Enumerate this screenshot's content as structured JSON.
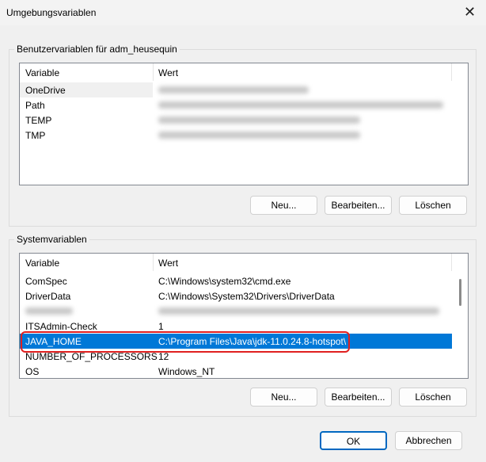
{
  "window": {
    "title": "Umgebungsvariablen",
    "close_icon": "close-icon"
  },
  "user_group": {
    "label": "Benutzervariablen für adm_heusequin",
    "columns": [
      "Variable",
      "Wert"
    ],
    "rows": [
      {
        "name": "OneDrive"
      },
      {
        "name": "Path"
      },
      {
        "name": "TEMP"
      },
      {
        "name": "TMP"
      }
    ],
    "buttons": {
      "new": "Neu...",
      "edit": "Bearbeiten...",
      "delete": "Löschen"
    }
  },
  "system_group": {
    "label": "Systemvariablen",
    "columns": [
      "Variable",
      "Wert"
    ],
    "rows": [
      {
        "name": "ComSpec",
        "value": "C:\\Windows\\system32\\cmd.exe"
      },
      {
        "name": "DriverData",
        "value": "C:\\Windows\\System32\\Drivers\\DriverData"
      },
      {
        "name": "",
        "value": ""
      },
      {
        "name": "ITSAdmin-Check",
        "value": "1"
      },
      {
        "name": "JAVA_HOME",
        "value": "C:\\Program Files\\Java\\jdk-11.0.24.8-hotspot\\"
      },
      {
        "name": "NUMBER_OF_PROCESSORS",
        "value": "12"
      },
      {
        "name": "OS",
        "value": "Windows_NT"
      }
    ],
    "selected": "JAVA_HOME",
    "buttons": {
      "new": "Neu...",
      "edit": "Bearbeiten...",
      "delete": "Löschen"
    }
  },
  "footer": {
    "ok": "OK",
    "cancel": "Abbrechen"
  },
  "colors": {
    "selection": "#0078d7",
    "highlight": "#e02020"
  }
}
